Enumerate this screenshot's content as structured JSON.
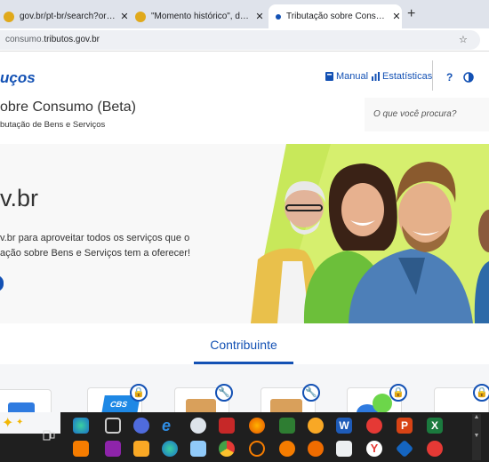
{
  "browser": {
    "tabs": [
      {
        "title": "gov.br/pt-br/search?origem=fo",
        "close": "✕",
        "active": false
      },
      {
        "title": "\"Momento histórico\", diz Lula d",
        "close": "✕",
        "active": false
      },
      {
        "title": "Tributação sobre Consumo (Bet",
        "close": "✕",
        "active": true
      }
    ],
    "new_tab": "+",
    "url_prefix": "consumo.",
    "url_domain": "tributos.gov.br"
  },
  "header": {
    "brand": "uços",
    "manual": "Manual",
    "stats": "Estatísticas",
    "help": "?",
    "title": "obre Consumo (Beta)",
    "subtitle": "butação de Bens e Serviços",
    "search_placeholder": "O que você procura?"
  },
  "hero": {
    "heading": "v.br",
    "line1": "v.br para aproveitar todos os serviços que o",
    "line2": "ação sobre Bens e Serviços tem a oferecer!"
  },
  "section": {
    "contribuinte": "Contribuinte"
  },
  "cards": {
    "cbs_label": "CBS"
  },
  "colors": {
    "brand": "#1351b4",
    "hero_green": "#c8e85a"
  }
}
